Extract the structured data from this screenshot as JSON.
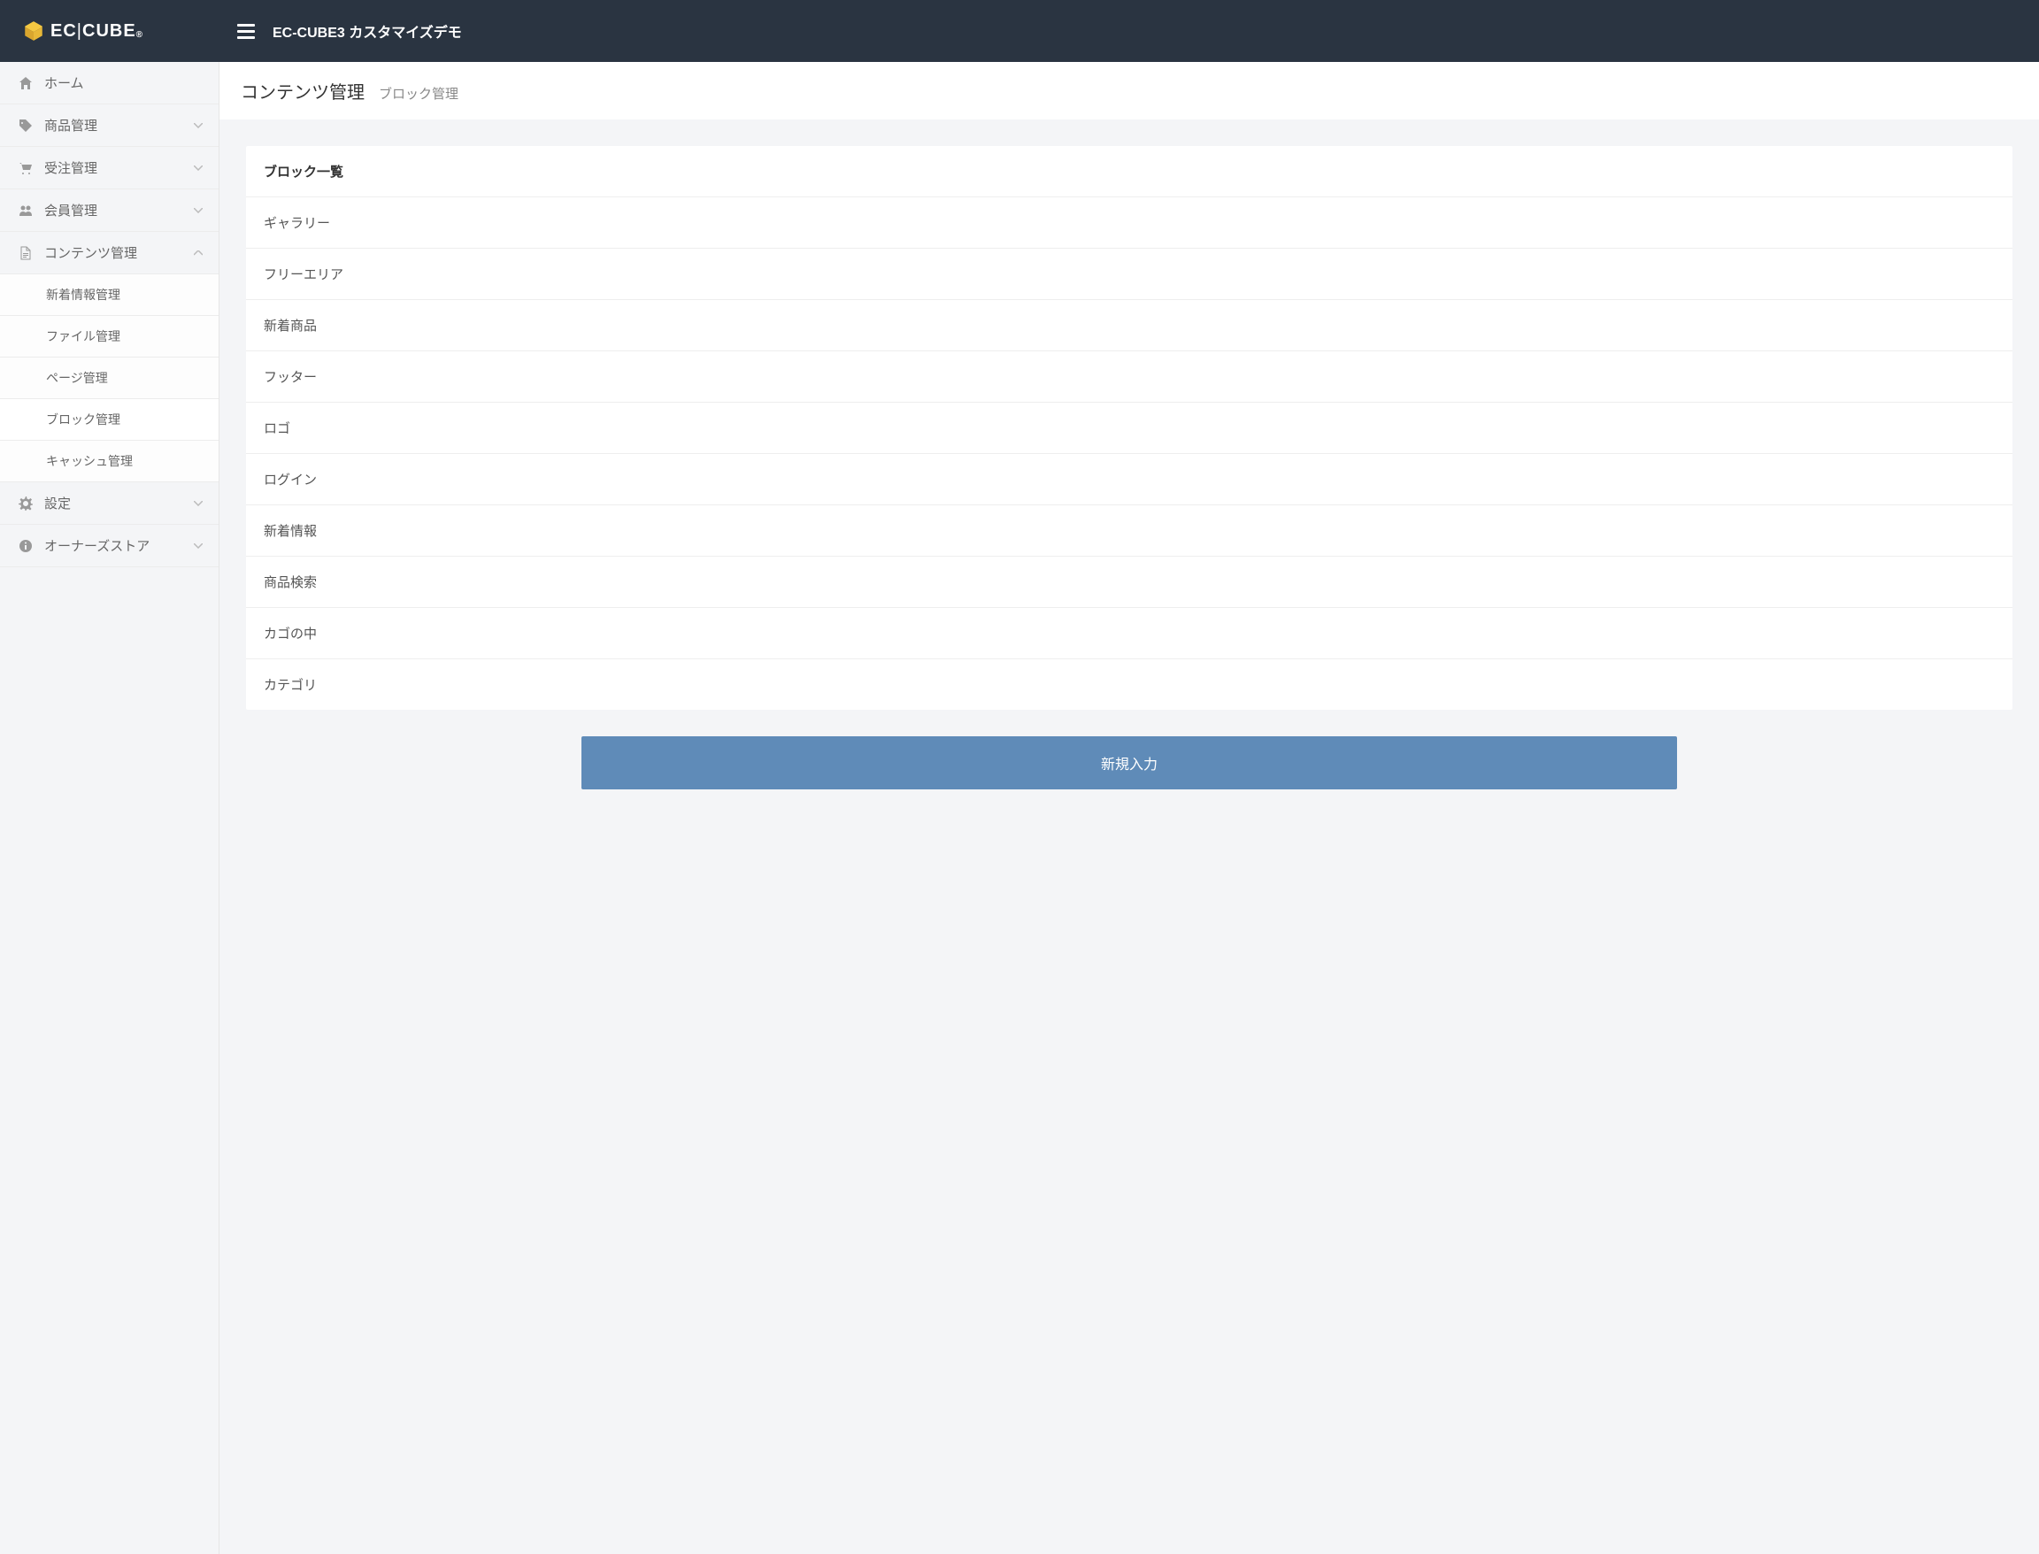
{
  "header": {
    "logo_text_1": "EC",
    "logo_text_2": "CUBE",
    "title": "EC-CUBE3 カスタマイズデモ"
  },
  "sidebar": {
    "items": [
      {
        "label": "ホーム",
        "icon": "home",
        "expandable": false
      },
      {
        "label": "商品管理",
        "icon": "tag",
        "expandable": true,
        "expanded": false
      },
      {
        "label": "受注管理",
        "icon": "cart",
        "expandable": true,
        "expanded": false
      },
      {
        "label": "会員管理",
        "icon": "users",
        "expandable": true,
        "expanded": false
      },
      {
        "label": "コンテンツ管理",
        "icon": "file",
        "expandable": true,
        "expanded": true,
        "children": [
          {
            "label": "新着情報管理",
            "active": false
          },
          {
            "label": "ファイル管理",
            "active": false
          },
          {
            "label": "ページ管理",
            "active": false
          },
          {
            "label": "ブロック管理",
            "active": true
          },
          {
            "label": "キャッシュ管理",
            "active": false
          }
        ]
      },
      {
        "label": "設定",
        "icon": "gear",
        "expandable": true,
        "expanded": false
      },
      {
        "label": "オーナーズストア",
        "icon": "info",
        "expandable": true,
        "expanded": false
      }
    ]
  },
  "page": {
    "title": "コンテンツ管理",
    "subtitle": "ブロック管理"
  },
  "panel": {
    "heading": "ブロック一覧",
    "items": [
      "ギャラリー",
      "フリーエリア",
      "新着商品",
      "フッター",
      "ロゴ",
      "ログイン",
      "新着情報",
      "商品検索",
      "カゴの中",
      "カテゴリ"
    ]
  },
  "buttons": {
    "new": "新規入力"
  }
}
